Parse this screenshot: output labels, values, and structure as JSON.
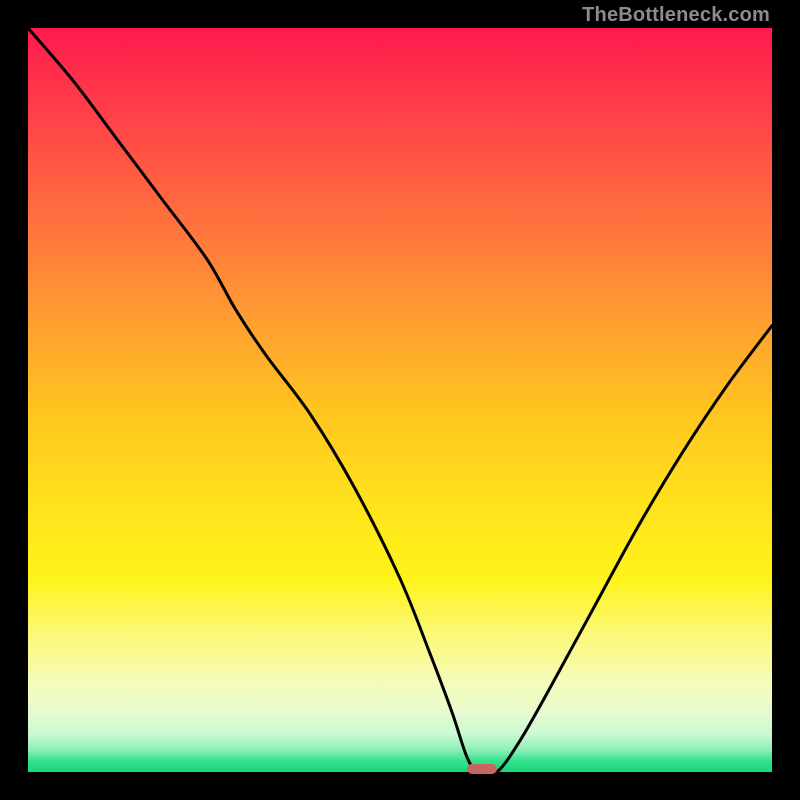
{
  "watermark": "TheBottleneck.com",
  "marker": {
    "x_percent": 61,
    "width_percent": 4
  },
  "chart_data": {
    "type": "line",
    "title": "",
    "xlabel": "",
    "ylabel": "",
    "xlim": [
      0,
      100
    ],
    "ylim": [
      0,
      100
    ],
    "grid": false,
    "legend": false,
    "series": [
      {
        "name": "bottleneck-curve",
        "x": [
          0,
          6,
          12,
          18,
          24,
          28,
          32,
          38,
          44,
          50,
          54,
          57,
          59,
          60.5,
          63,
          66,
          70,
          76,
          82,
          88,
          94,
          100
        ],
        "y": [
          100,
          93,
          85,
          77,
          69,
          62,
          56,
          48,
          38,
          26,
          16,
          8,
          2,
          0,
          0,
          4,
          11,
          22,
          33,
          43,
          52,
          60
        ]
      }
    ],
    "annotations": [
      {
        "type": "marker",
        "x_percent": 61,
        "width_percent": 4,
        "color": "#c96464"
      }
    ],
    "background_gradient": {
      "stops": [
        {
          "pct": 0,
          "color": "#ff1a4d"
        },
        {
          "pct": 50,
          "color": "#ffd21e"
        },
        {
          "pct": 86,
          "color": "#fff6b0"
        },
        {
          "pct": 100,
          "color": "#14d977"
        }
      ]
    }
  }
}
